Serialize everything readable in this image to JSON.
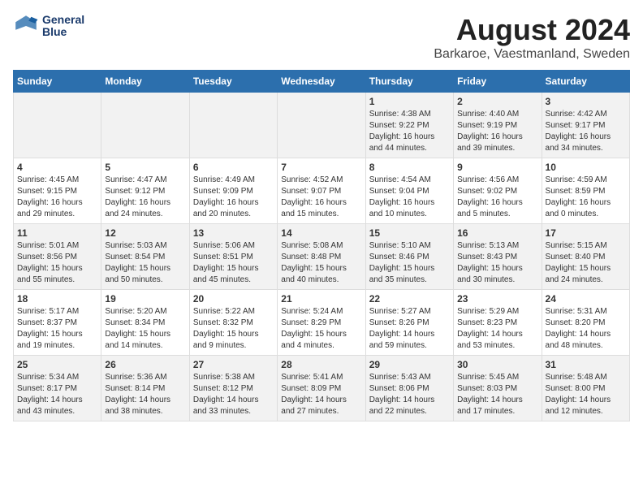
{
  "logo": {
    "line1": "General",
    "line2": "Blue"
  },
  "title": "August 2024",
  "subtitle": "Barkaroe, Vaestmanland, Sweden",
  "headers": [
    "Sunday",
    "Monday",
    "Tuesday",
    "Wednesday",
    "Thursday",
    "Friday",
    "Saturday"
  ],
  "weeks": [
    [
      {
        "day": "",
        "text": ""
      },
      {
        "day": "",
        "text": ""
      },
      {
        "day": "",
        "text": ""
      },
      {
        "day": "",
        "text": ""
      },
      {
        "day": "1",
        "text": "Sunrise: 4:38 AM\nSunset: 9:22 PM\nDaylight: 16 hours\nand 44 minutes."
      },
      {
        "day": "2",
        "text": "Sunrise: 4:40 AM\nSunset: 9:19 PM\nDaylight: 16 hours\nand 39 minutes."
      },
      {
        "day": "3",
        "text": "Sunrise: 4:42 AM\nSunset: 9:17 PM\nDaylight: 16 hours\nand 34 minutes."
      }
    ],
    [
      {
        "day": "4",
        "text": "Sunrise: 4:45 AM\nSunset: 9:15 PM\nDaylight: 16 hours\nand 29 minutes."
      },
      {
        "day": "5",
        "text": "Sunrise: 4:47 AM\nSunset: 9:12 PM\nDaylight: 16 hours\nand 24 minutes."
      },
      {
        "day": "6",
        "text": "Sunrise: 4:49 AM\nSunset: 9:09 PM\nDaylight: 16 hours\nand 20 minutes."
      },
      {
        "day": "7",
        "text": "Sunrise: 4:52 AM\nSunset: 9:07 PM\nDaylight: 16 hours\nand 15 minutes."
      },
      {
        "day": "8",
        "text": "Sunrise: 4:54 AM\nSunset: 9:04 PM\nDaylight: 16 hours\nand 10 minutes."
      },
      {
        "day": "9",
        "text": "Sunrise: 4:56 AM\nSunset: 9:02 PM\nDaylight: 16 hours\nand 5 minutes."
      },
      {
        "day": "10",
        "text": "Sunrise: 4:59 AM\nSunset: 8:59 PM\nDaylight: 16 hours\nand 0 minutes."
      }
    ],
    [
      {
        "day": "11",
        "text": "Sunrise: 5:01 AM\nSunset: 8:56 PM\nDaylight: 15 hours\nand 55 minutes."
      },
      {
        "day": "12",
        "text": "Sunrise: 5:03 AM\nSunset: 8:54 PM\nDaylight: 15 hours\nand 50 minutes."
      },
      {
        "day": "13",
        "text": "Sunrise: 5:06 AM\nSunset: 8:51 PM\nDaylight: 15 hours\nand 45 minutes."
      },
      {
        "day": "14",
        "text": "Sunrise: 5:08 AM\nSunset: 8:48 PM\nDaylight: 15 hours\nand 40 minutes."
      },
      {
        "day": "15",
        "text": "Sunrise: 5:10 AM\nSunset: 8:46 PM\nDaylight: 15 hours\nand 35 minutes."
      },
      {
        "day": "16",
        "text": "Sunrise: 5:13 AM\nSunset: 8:43 PM\nDaylight: 15 hours\nand 30 minutes."
      },
      {
        "day": "17",
        "text": "Sunrise: 5:15 AM\nSunset: 8:40 PM\nDaylight: 15 hours\nand 24 minutes."
      }
    ],
    [
      {
        "day": "18",
        "text": "Sunrise: 5:17 AM\nSunset: 8:37 PM\nDaylight: 15 hours\nand 19 minutes."
      },
      {
        "day": "19",
        "text": "Sunrise: 5:20 AM\nSunset: 8:34 PM\nDaylight: 15 hours\nand 14 minutes."
      },
      {
        "day": "20",
        "text": "Sunrise: 5:22 AM\nSunset: 8:32 PM\nDaylight: 15 hours\nand 9 minutes."
      },
      {
        "day": "21",
        "text": "Sunrise: 5:24 AM\nSunset: 8:29 PM\nDaylight: 15 hours\nand 4 minutes."
      },
      {
        "day": "22",
        "text": "Sunrise: 5:27 AM\nSunset: 8:26 PM\nDaylight: 14 hours\nand 59 minutes."
      },
      {
        "day": "23",
        "text": "Sunrise: 5:29 AM\nSunset: 8:23 PM\nDaylight: 14 hours\nand 53 minutes."
      },
      {
        "day": "24",
        "text": "Sunrise: 5:31 AM\nSunset: 8:20 PM\nDaylight: 14 hours\nand 48 minutes."
      }
    ],
    [
      {
        "day": "25",
        "text": "Sunrise: 5:34 AM\nSunset: 8:17 PM\nDaylight: 14 hours\nand 43 minutes."
      },
      {
        "day": "26",
        "text": "Sunrise: 5:36 AM\nSunset: 8:14 PM\nDaylight: 14 hours\nand 38 minutes."
      },
      {
        "day": "27",
        "text": "Sunrise: 5:38 AM\nSunset: 8:12 PM\nDaylight: 14 hours\nand 33 minutes."
      },
      {
        "day": "28",
        "text": "Sunrise: 5:41 AM\nSunset: 8:09 PM\nDaylight: 14 hours\nand 27 minutes."
      },
      {
        "day": "29",
        "text": "Sunrise: 5:43 AM\nSunset: 8:06 PM\nDaylight: 14 hours\nand 22 minutes."
      },
      {
        "day": "30",
        "text": "Sunrise: 5:45 AM\nSunset: 8:03 PM\nDaylight: 14 hours\nand 17 minutes."
      },
      {
        "day": "31",
        "text": "Sunrise: 5:48 AM\nSunset: 8:00 PM\nDaylight: 14 hours\nand 12 minutes."
      }
    ]
  ]
}
